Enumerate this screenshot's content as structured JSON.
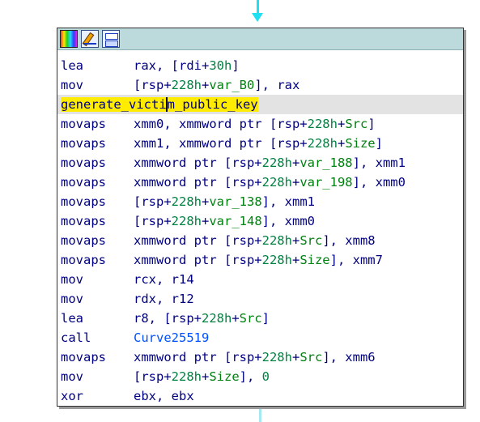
{
  "toolbar": {
    "icons": [
      "color-palette-icon",
      "rename-edit-icon",
      "graph-view-icon"
    ]
  },
  "colors": {
    "node_header": "#bcd9dc",
    "mnemonic_text": "#000080",
    "symbol": "#00800f",
    "function_call": "#0050ff",
    "label_highlight": "#ffec00",
    "edge": "#1ee0f0"
  },
  "label": "generate_victim_public_key",
  "instructions": [
    {
      "mnemonic": "lea",
      "operands": "rax, [rdi+30h]"
    },
    {
      "mnemonic": "mov",
      "operands": "[rsp+228h+var_B0], rax"
    },
    {
      "mnemonic": "movaps",
      "operands": "xmm0, xmmword ptr [rsp+228h+Src]"
    },
    {
      "mnemonic": "movaps",
      "operands": "xmm1, xmmword ptr [rsp+228h+Size]"
    },
    {
      "mnemonic": "movaps",
      "operands": "xmmword ptr [rsp+228h+var_188], xmm1"
    },
    {
      "mnemonic": "movaps",
      "operands": "xmmword ptr [rsp+228h+var_198], xmm0"
    },
    {
      "mnemonic": "movaps",
      "operands": "[rsp+228h+var_138], xmm1"
    },
    {
      "mnemonic": "movaps",
      "operands": "[rsp+228h+var_148], xmm0"
    },
    {
      "mnemonic": "movaps",
      "operands": "xmmword ptr [rsp+228h+Src], xmm8"
    },
    {
      "mnemonic": "movaps",
      "operands": "xmmword ptr [rsp+228h+Size], xmm7"
    },
    {
      "mnemonic": "mov",
      "operands": "rcx, r14"
    },
    {
      "mnemonic": "mov",
      "operands": "rdx, r12"
    },
    {
      "mnemonic": "lea",
      "operands": "r8, [rsp+228h+Src]"
    },
    {
      "mnemonic": "call",
      "operands": "Curve25519"
    },
    {
      "mnemonic": "movaps",
      "operands": "xmmword ptr [rsp+228h+Src], xmm6"
    },
    {
      "mnemonic": "mov",
      "operands": "[rsp+228h+Size], 0"
    },
    {
      "mnemonic": "xor",
      "operands": "ebx, ebx"
    }
  ]
}
